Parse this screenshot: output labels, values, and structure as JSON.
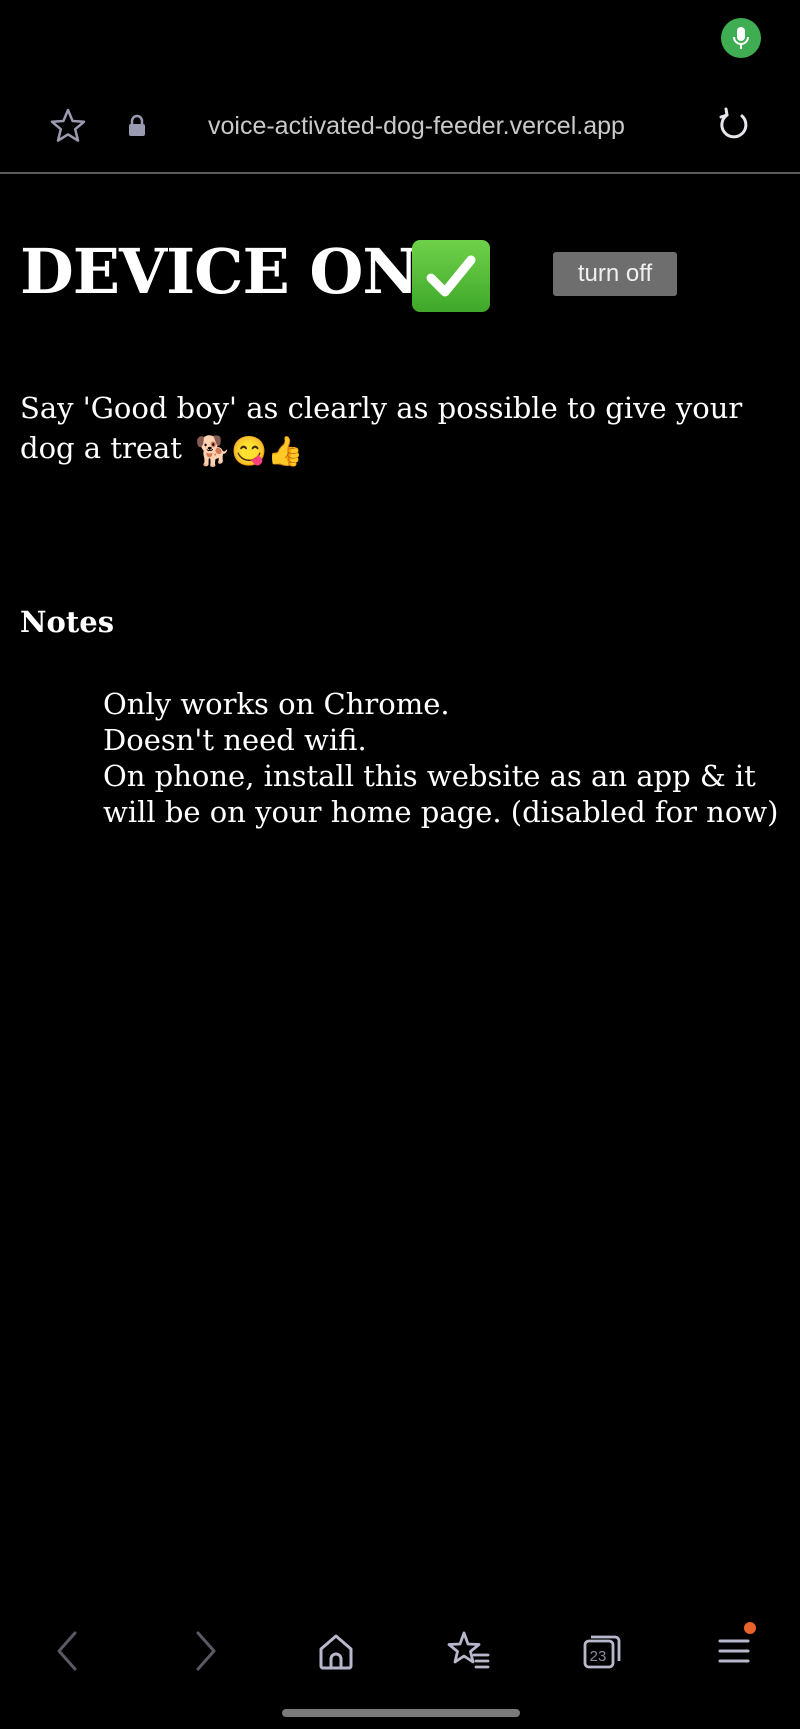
{
  "browser": {
    "url": "voice-activated-dog-feeder.vercel.app",
    "tab_count": "23",
    "icons": {
      "mic": "microphone-icon",
      "star": "star-icon",
      "lock": "lock-icon",
      "reload": "reload-icon",
      "back": "chevron-left-icon",
      "forward": "chevron-right-icon",
      "home": "home-icon",
      "bookmarks": "bookmark-list-icon",
      "tabs": "tabs-icon",
      "menu": "menu-icon"
    },
    "colors": {
      "mic_indicator": "#3fae52",
      "menu_notification_dot": "#e8622a",
      "nav_icon": "#8a8aa0"
    }
  },
  "page": {
    "status_title": "DEVICE ON",
    "status_emoji": "✅",
    "turn_off_label": "turn off",
    "instruction": "Say 'Good boy' as clearly as possible to give your dog a treat",
    "instruction_emojis": [
      "🐕",
      "😋",
      "👍"
    ],
    "notes_heading": "Notes",
    "notes": [
      "Only works on Chrome.",
      "Doesn't need wifi.",
      "On phone, install this website as an app & it will be on your home page. (disabled for now)"
    ],
    "colors": {
      "background": "#000000",
      "text": "#ffffff",
      "button_bg": "#6e6e6e",
      "check_green": "#4cbb35"
    }
  }
}
